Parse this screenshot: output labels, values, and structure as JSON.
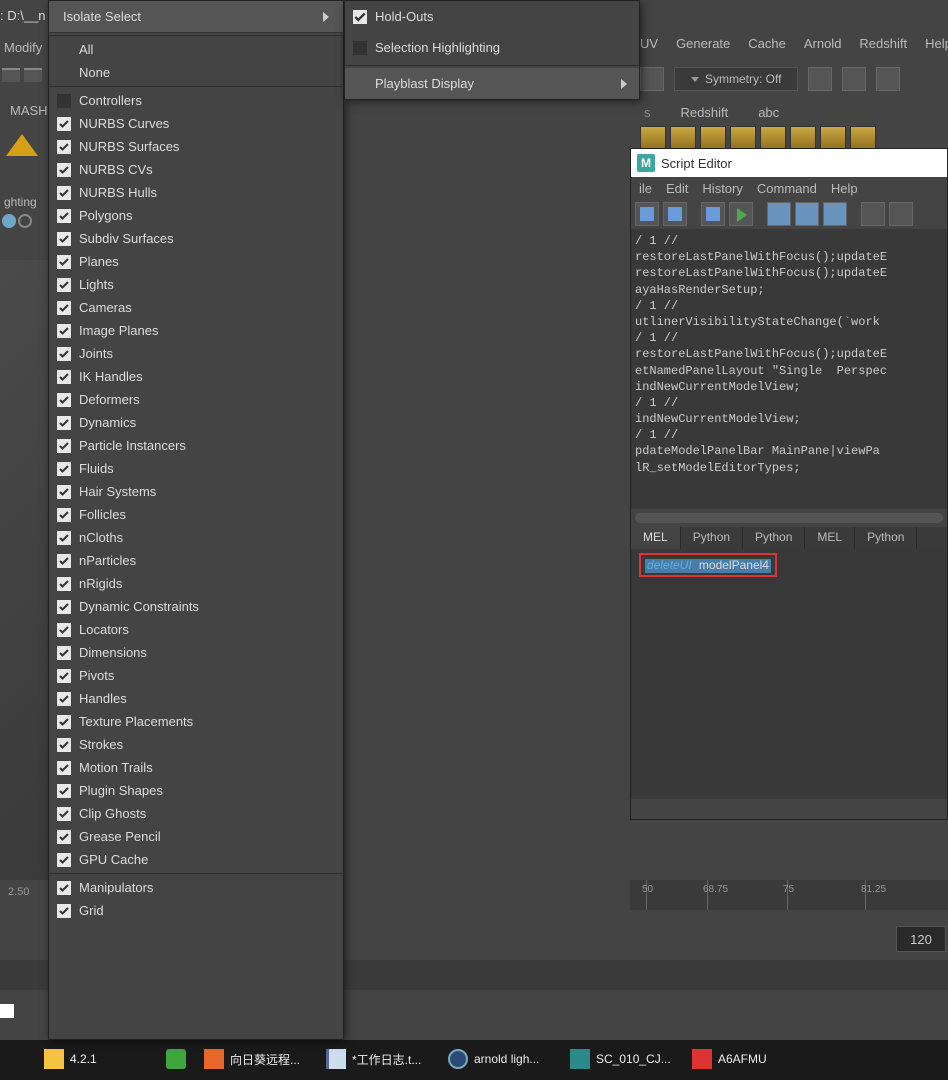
{
  "title_fragment": ": D:\\__n",
  "modify_label": "Modify",
  "mash_label": "MASH",
  "lighting_label": "ghting",
  "value_250": "2.50",
  "top_menu": {
    "uv": "UV",
    "generate": "Generate",
    "cache": "Cache",
    "arnold": "Arnold",
    "redshift": "Redshift",
    "help": "Help"
  },
  "symmetry": "Symmetry: Off",
  "sec_tabs": {
    "redshift": "Redshift",
    "abc": "abc"
  },
  "show_menu": {
    "isolate": "Isolate Select",
    "all": "All",
    "none": "None",
    "items": [
      {
        "label": "Controllers",
        "checked": false
      },
      {
        "label": "NURBS Curves",
        "checked": true
      },
      {
        "label": "NURBS Surfaces",
        "checked": true
      },
      {
        "label": "NURBS CVs",
        "checked": true
      },
      {
        "label": "NURBS Hulls",
        "checked": true
      },
      {
        "label": "Polygons",
        "checked": true
      },
      {
        "label": "Subdiv Surfaces",
        "checked": true
      },
      {
        "label": "Planes",
        "checked": true
      },
      {
        "label": "Lights",
        "checked": true
      },
      {
        "label": "Cameras",
        "checked": true
      },
      {
        "label": "Image Planes",
        "checked": true
      },
      {
        "label": "Joints",
        "checked": true
      },
      {
        "label": "IK Handles",
        "checked": true
      },
      {
        "label": "Deformers",
        "checked": true
      },
      {
        "label": "Dynamics",
        "checked": true
      },
      {
        "label": "Particle Instancers",
        "checked": true
      },
      {
        "label": "Fluids",
        "checked": true
      },
      {
        "label": "Hair Systems",
        "checked": true
      },
      {
        "label": "Follicles",
        "checked": true
      },
      {
        "label": "nCloths",
        "checked": true
      },
      {
        "label": "nParticles",
        "checked": true
      },
      {
        "label": "nRigids",
        "checked": true
      },
      {
        "label": "Dynamic Constraints",
        "checked": true
      },
      {
        "label": "Locators",
        "checked": true
      },
      {
        "label": "Dimensions",
        "checked": true
      },
      {
        "label": "Pivots",
        "checked": true
      },
      {
        "label": "Handles",
        "checked": true
      },
      {
        "label": "Texture Placements",
        "checked": true
      },
      {
        "label": "Strokes",
        "checked": true
      },
      {
        "label": "Motion Trails",
        "checked": true
      },
      {
        "label": "Plugin Shapes",
        "checked": true
      },
      {
        "label": "Clip Ghosts",
        "checked": true
      },
      {
        "label": "Grease Pencil",
        "checked": true
      },
      {
        "label": "GPU Cache",
        "checked": true
      }
    ],
    "manip": "Manipulators",
    "grid": "Grid"
  },
  "sub_menu": {
    "holdouts": "Hold-Outs",
    "sel_highlight": "Selection Highlighting",
    "playblast": "Playblast Display"
  },
  "script_editor": {
    "title": "Script Editor",
    "menus": {
      "file": "ile",
      "edit": "Edit",
      "history": "History",
      "command": "Command",
      "help": "Help"
    },
    "output": "/ 1 //\nrestoreLastPanelWithFocus();updateE\nrestoreLastPanelWithFocus();updateE\nayaHasRenderSetup;\n/ 1 //\nutlinerVisibilityStateChange(`work\n/ 1 //\nrestoreLastPanelWithFocus();updateE\netNamedPanelLayout \"Single  Perspec\nindNewCurrentModelView;\n/ 1 //\nindNewCurrentModelView;\n/ 1 //\npdateModelPanelBar MainPane|viewPa\nlR_setModelEditorTypes;",
    "tabs": [
      "MEL",
      "Python",
      "Python",
      "MEL",
      "Python"
    ],
    "active_tab": 0,
    "cmd_keyword": "deleteUI",
    "cmd_arg": "modelPanel4"
  },
  "timeline": {
    "ticks": [
      {
        "label": "50",
        "pos": 16
      },
      {
        "label": "68.75",
        "pos": 77
      },
      {
        "label": "75",
        "pos": 157
      },
      {
        "label": "81.25",
        "pos": 235
      }
    ]
  },
  "frame_value": "120",
  "taskbar": {
    "items": [
      {
        "label": "4.2.1",
        "icon": "folder"
      },
      {
        "label": "",
        "icon": "green"
      },
      {
        "label": "向日葵远程...",
        "icon": "orange"
      },
      {
        "label": "*工作日志.t...",
        "icon": "note"
      },
      {
        "label": "arnold ligh...",
        "icon": "blue"
      },
      {
        "label": "SC_010_CJ...",
        "icon": "maya"
      },
      {
        "label": "A6AFMU",
        "icon": "wps"
      }
    ]
  }
}
